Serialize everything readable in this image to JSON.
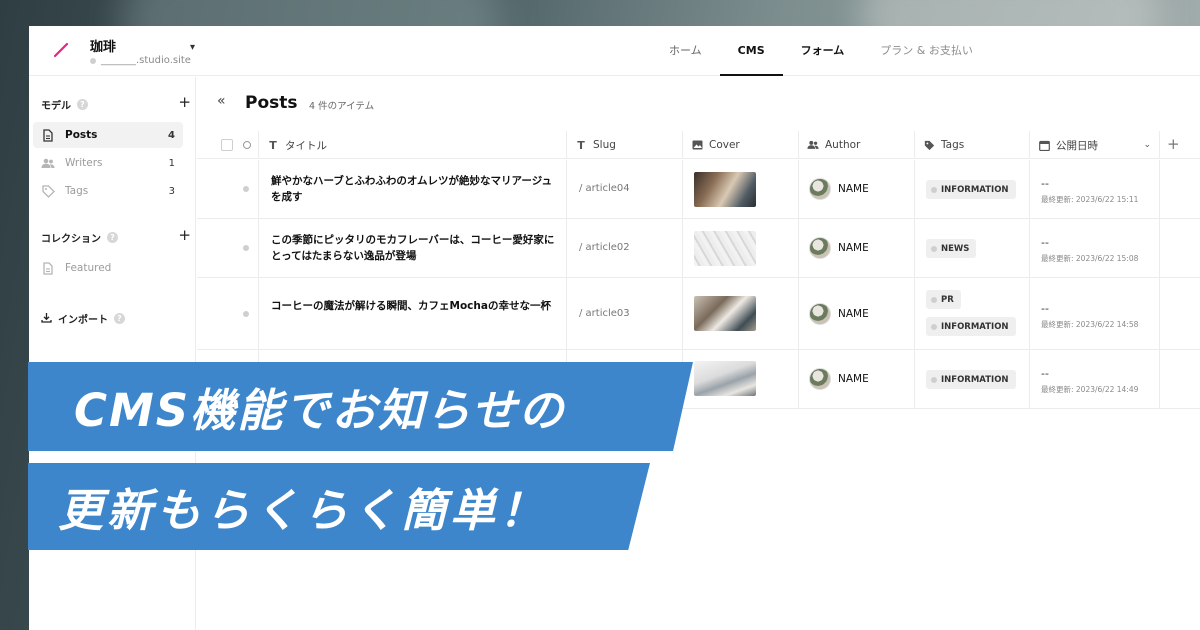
{
  "app": {
    "site_name": "珈琲",
    "site_url": "_______.studio.site",
    "brand_color": "#e8247d"
  },
  "nav": {
    "tabs": [
      {
        "label": "ホーム"
      },
      {
        "label": "CMS"
      },
      {
        "label": "フォーム"
      },
      {
        "label": "プラン & お支払い"
      }
    ]
  },
  "sidebar": {
    "models_label": "モデル",
    "models": [
      {
        "label": "Posts",
        "count": "4",
        "icon": "document-icon"
      },
      {
        "label": "Writers",
        "count": "1",
        "icon": "people-icon"
      },
      {
        "label": "Tags",
        "count": "3",
        "icon": "tag-icon"
      }
    ],
    "collections_label": "コレクション",
    "collections": [
      {
        "label": "Featured",
        "icon": "document-icon"
      }
    ],
    "import_label": "インポート"
  },
  "main": {
    "title": "Posts",
    "count_text": "4 件のアイテム",
    "columns": [
      {
        "label": "タイトル",
        "icon": "text-icon"
      },
      {
        "label": "Slug",
        "icon": "text-icon"
      },
      {
        "label": "Cover",
        "icon": "image-icon"
      },
      {
        "label": "Author",
        "icon": "people-icon"
      },
      {
        "label": "Tags",
        "icon": "tag-icon"
      },
      {
        "label": "公開日時",
        "icon": "calendar-icon"
      }
    ],
    "rows": [
      {
        "title": "鮮やかなハーブとふわふわのオムレツが絶妙なマリアージュを成す",
        "slug": "/ article04",
        "author": "NAME",
        "tags": [
          "INFORMATION"
        ],
        "date": "--",
        "updated": "最終更新: 2023/6/22 15:11"
      },
      {
        "title": "この季節にピッタリのモカフレーバーは、コーヒー愛好家にとってはたまらない逸品が登場",
        "slug": "/ article02",
        "author": "NAME",
        "tags": [
          "NEWS"
        ],
        "date": "--",
        "updated": "最終更新: 2023/6/22 15:08"
      },
      {
        "title": "コーヒーの魔法が解ける瞬間、カフェMochaの幸せな一杯",
        "slug": "/ article03",
        "author": "NAME",
        "tags": [
          "PR",
          "INFORMATION"
        ],
        "date": "--",
        "updated": "最終更新: 2023/6/22 14:58"
      },
      {
        "title": "",
        "slug": "",
        "author": "NAME",
        "tags": [
          "INFORMATION"
        ],
        "date": "--",
        "updated": "最終更新: 2023/6/22 14:49"
      }
    ]
  },
  "banner": {
    "line1": "CMS機能でお知らせの",
    "line2": "更新もらくらく簡単！",
    "color": "#3d86cc"
  }
}
